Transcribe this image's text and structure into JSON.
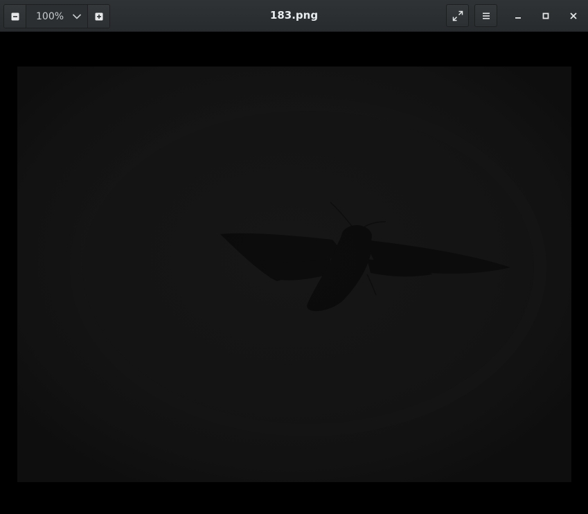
{
  "window": {
    "title": "183.png"
  },
  "toolbar": {
    "zoom_value": "100%",
    "zoom_out_icon": "minus-icon",
    "zoom_in_icon": "plus-icon",
    "zoom_dropdown_icon": "chevron-down-icon",
    "fullscreen_icon": "fullscreen-icon",
    "menu_icon": "hamburger-menu-icon"
  },
  "window_controls": {
    "minimize_icon": "minimize-icon",
    "maximize_icon": "maximize-icon",
    "close_icon": "close-icon"
  },
  "colors": {
    "headerbar": "#2c3032",
    "background": "#000000",
    "image_bg": "#131313",
    "title_text": "#e8ecee"
  }
}
